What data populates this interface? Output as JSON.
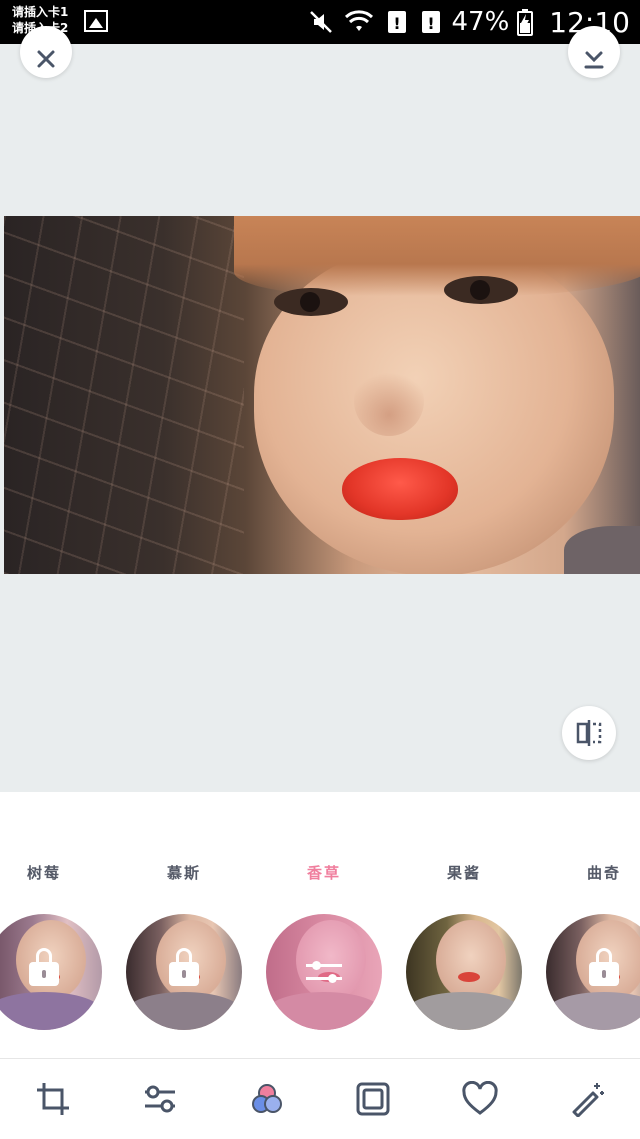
{
  "status_bar": {
    "sim1": "请插入卡1",
    "sim2": "请插入卡2",
    "battery": "47%",
    "time": "12:10"
  },
  "filters": [
    {
      "label": "树莓",
      "locked": true,
      "active": false
    },
    {
      "label": "慕斯",
      "locked": true,
      "active": false
    },
    {
      "label": "香草",
      "locked": false,
      "active": true
    },
    {
      "label": "果酱",
      "locked": false,
      "active": false
    },
    {
      "label": "曲奇",
      "locked": true,
      "active": false
    }
  ],
  "toolbar": {
    "items": [
      "crop-icon",
      "adjust-icon",
      "filters-icon",
      "frame-icon",
      "favorite-icon",
      "magic-wand-icon"
    ]
  },
  "colors": {
    "accent": "#f07f9e",
    "label": "#555a68",
    "icon": "#4a5568",
    "editor_bg": "#e9edee"
  }
}
